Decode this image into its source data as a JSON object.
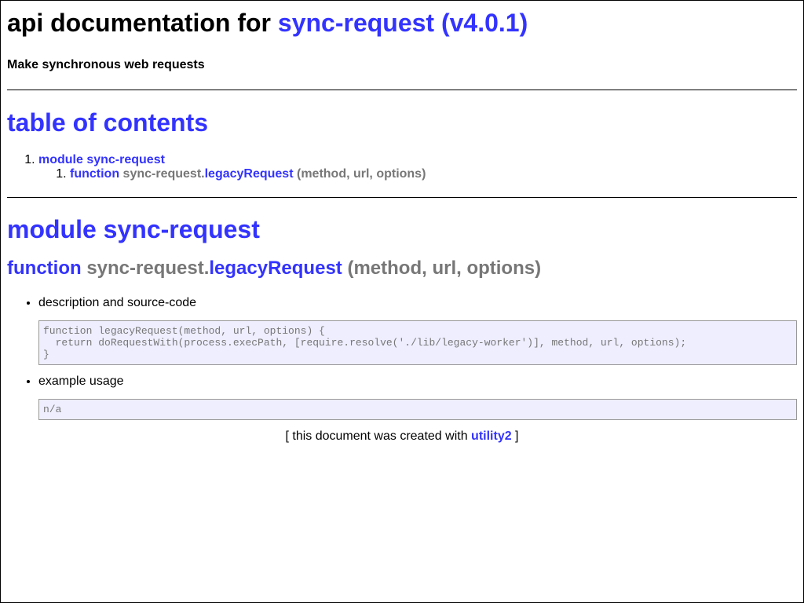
{
  "header": {
    "title_prefix": "api documentation for ",
    "title_link": "sync-request (v4.0.1)",
    "subtitle": "Make synchronous web requests"
  },
  "toc": {
    "heading": "table of contents",
    "module_label": "module sync-request",
    "function_keyword": "function",
    "function_namespace": "sync-request.",
    "function_name": "legacyRequest",
    "function_args": "(method, url, options)"
  },
  "module": {
    "heading": "module sync-request",
    "function_keyword": "function",
    "function_namespace": "sync-request.",
    "function_name": "legacyRequest",
    "function_args": "(method, url, options)",
    "description_label": "description and source-code",
    "source_code": "function legacyRequest(method, url, options) {\n  return doRequestWith(process.execPath, [require.resolve('./lib/legacy-worker')], method, url, options);\n}",
    "example_label": "example usage",
    "example_code": "n/a"
  },
  "footer": {
    "prefix": "[ this document was created with ",
    "link": "utility2",
    "suffix": " ]"
  }
}
